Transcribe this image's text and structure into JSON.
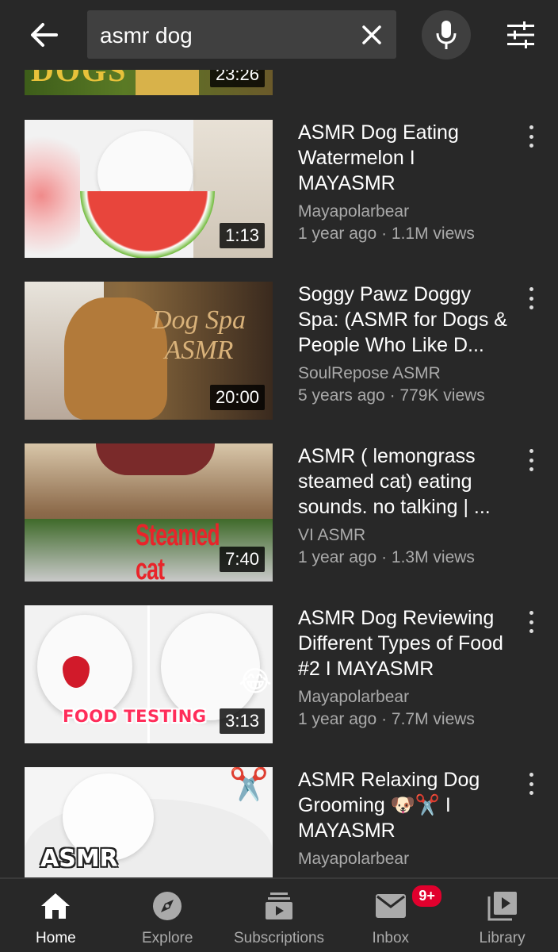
{
  "search": {
    "query": "asmr dog"
  },
  "icons": {
    "back": "arrow-left-icon",
    "clear": "close-icon",
    "mic": "mic-icon",
    "filter": "sliders-icon",
    "more": "more-vertical-icon"
  },
  "colors": {
    "background": "#282828",
    "search_bg": "#404040",
    "text_primary": "#ffffff",
    "text_secondary": "#aaaaaa",
    "badge": "#e1002d"
  },
  "results": [
    {
      "title": "",
      "channel": "",
      "stats": "",
      "duration": "23:26",
      "thumb_text": "DOGS"
    },
    {
      "title": "ASMR Dog Eating Watermelon I MAYASMR",
      "channel": "Mayapolarbear",
      "stats": "1 year ago · 1.1M views",
      "duration": "1:13"
    },
    {
      "title": "Soggy Pawz Doggy Spa: (ASMR for Dogs & People Who Like D...",
      "channel": "SoulRepose ASMR",
      "stats": "5 years ago · 779K views",
      "duration": "20:00",
      "thumb_text": "Dog Spa ASMR"
    },
    {
      "title": "ASMR ( lemongrass steamed cat) eating sounds. no talking | ...",
      "channel": "VI ASMR",
      "stats": "1 year ago · 1.3M views",
      "duration": "7:40",
      "thumb_text": "Steamed cat"
    },
    {
      "title": "ASMR Dog Reviewing Different Types of Food #2 I MAYASMR",
      "channel": "Mayapolarbear",
      "stats": "1 year ago · 7.7M views",
      "duration": "3:13",
      "thumb_text": "FOOD TESTING"
    },
    {
      "title": "ASMR Relaxing Dog Grooming 🐶✂️ I MAYASMR",
      "channel": "Mayapolarbear",
      "stats": "",
      "duration": "",
      "thumb_text": "ASMR"
    }
  ],
  "nav": [
    {
      "label": "Home",
      "icon": "home-icon",
      "active": true
    },
    {
      "label": "Explore",
      "icon": "compass-icon"
    },
    {
      "label": "Subscriptions",
      "icon": "subscriptions-icon"
    },
    {
      "label": "Inbox",
      "icon": "mail-icon",
      "badge": "9+"
    },
    {
      "label": "Library",
      "icon": "library-icon"
    }
  ]
}
